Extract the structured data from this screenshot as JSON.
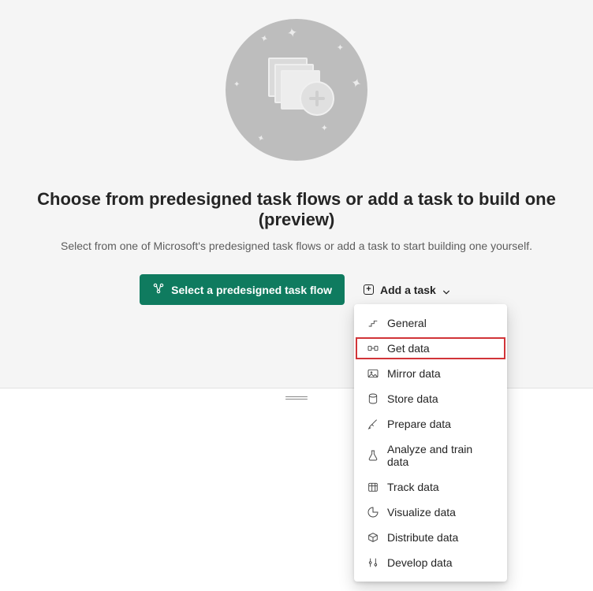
{
  "hero": {
    "headline": "Choose from predesigned task flows or add a task to build one (preview)",
    "subheadline": "Select from one of Microsoft's predesigned task flows or add a task to start building one yourself."
  },
  "actions": {
    "primary_label": "Select a predesigned task flow",
    "add_task_label": "Add a task"
  },
  "menu": {
    "items": [
      {
        "label": "General",
        "highlighted": false
      },
      {
        "label": "Get data",
        "highlighted": true
      },
      {
        "label": "Mirror data",
        "highlighted": false
      },
      {
        "label": "Store data",
        "highlighted": false
      },
      {
        "label": "Prepare data",
        "highlighted": false
      },
      {
        "label": "Analyze and train data",
        "highlighted": false
      },
      {
        "label": "Track data",
        "highlighted": false
      },
      {
        "label": "Visualize data",
        "highlighted": false
      },
      {
        "label": "Distribute data",
        "highlighted": false
      },
      {
        "label": "Develop data",
        "highlighted": false
      }
    ]
  }
}
